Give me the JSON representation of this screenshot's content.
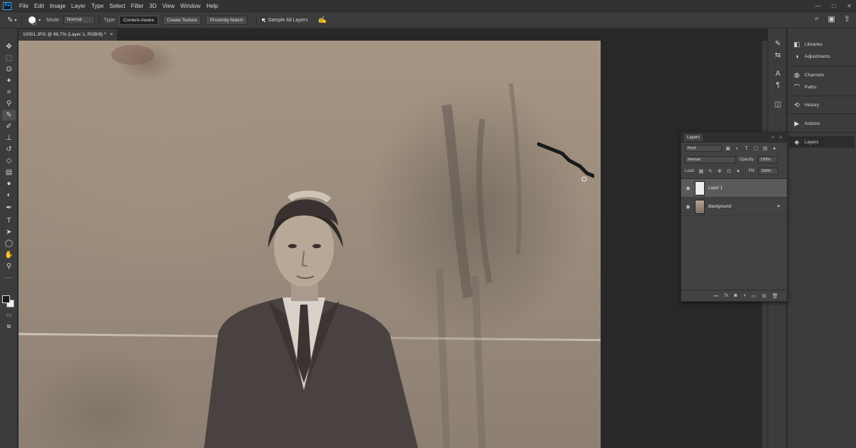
{
  "menu": {
    "logo": "Ps",
    "items": [
      "File",
      "Edit",
      "Image",
      "Layer",
      "Type",
      "Select",
      "Filter",
      "3D",
      "View",
      "Window",
      "Help"
    ],
    "window_controls": [
      "—",
      "□",
      "✕"
    ]
  },
  "options": {
    "brush_size": "23",
    "mode_label": "Mode:",
    "mode_value": "Normal",
    "type_label": "Type:",
    "type_buttons": [
      "Content-Aware",
      "Create Texture",
      "Proximity Match"
    ],
    "sample_all_layers": "Sample All Layers"
  },
  "document": {
    "tab_title": "10001.JPG @ 66.7% (Layer 1, RGB/8) *",
    "close": "×"
  },
  "tools": [
    {
      "icon": "move-icon",
      "glyph": "✥"
    },
    {
      "icon": "marquee-icon",
      "glyph": "⬚"
    },
    {
      "icon": "lasso-icon",
      "glyph": "ʘ"
    },
    {
      "icon": "magic-wand-icon",
      "glyph": "✦"
    },
    {
      "icon": "crop-icon",
      "glyph": "⌗"
    },
    {
      "icon": "eyedropper-icon",
      "glyph": "⚲"
    },
    {
      "icon": "spot-healing-brush-icon",
      "glyph": "✎"
    },
    {
      "icon": "brush-icon",
      "glyph": "✐"
    },
    {
      "icon": "clone-stamp-icon",
      "glyph": "⊥"
    },
    {
      "icon": "history-brush-icon",
      "glyph": "↺"
    },
    {
      "icon": "eraser-icon",
      "glyph": "◇"
    },
    {
      "icon": "gradient-icon",
      "glyph": "▤"
    },
    {
      "icon": "blur-icon",
      "glyph": "●"
    },
    {
      "icon": "dodge-icon",
      "glyph": "◐"
    },
    {
      "icon": "pen-icon",
      "glyph": "✒"
    },
    {
      "icon": "type-icon",
      "glyph": "T"
    },
    {
      "icon": "path-selection-icon",
      "glyph": "➤"
    },
    {
      "icon": "shape-icon",
      "glyph": "◯"
    },
    {
      "icon": "hand-icon",
      "glyph": "✋"
    },
    {
      "icon": "zoom-icon",
      "glyph": "⚲"
    },
    {
      "icon": "more-tools-icon",
      "glyph": "···"
    }
  ],
  "dock_icons": [
    {
      "name": "libraries-icon",
      "glyph": "✎"
    },
    {
      "name": "adjustments-icon",
      "glyph": "⇆"
    },
    {
      "name": "character-icon",
      "glyph": "A"
    },
    {
      "name": "paragraph-icon",
      "glyph": "¶"
    },
    {
      "name": "properties-icon",
      "glyph": "◫"
    }
  ],
  "panels": [
    {
      "label": "Libraries",
      "icon": "libraries-icon",
      "glyph": "◧"
    },
    {
      "label": "Adjustments",
      "icon": "adjustments-icon",
      "glyph": "◑"
    },
    {
      "label": "Channels",
      "icon": "channels-icon",
      "glyph": "◍"
    },
    {
      "label": "Paths",
      "icon": "paths-icon",
      "glyph": "⌒"
    },
    {
      "label": "History",
      "icon": "history-icon",
      "glyph": "⟲"
    },
    {
      "label": "Actions",
      "icon": "actions-icon",
      "glyph": "▶"
    },
    {
      "label": "Layers",
      "icon": "layers-icon",
      "glyph": "◈"
    }
  ],
  "layers_panel": {
    "tab": "Layers",
    "filter_kind": "Kind",
    "blend_mode": "Normal",
    "opacity_label": "Opacity:",
    "opacity_value": "100%",
    "lock_label": "Lock:",
    "fill_label": "Fill:",
    "fill_value": "100%",
    "layers": [
      {
        "name": "Layer 1",
        "selected": true
      },
      {
        "name": "Background",
        "selected": false
      }
    ]
  }
}
